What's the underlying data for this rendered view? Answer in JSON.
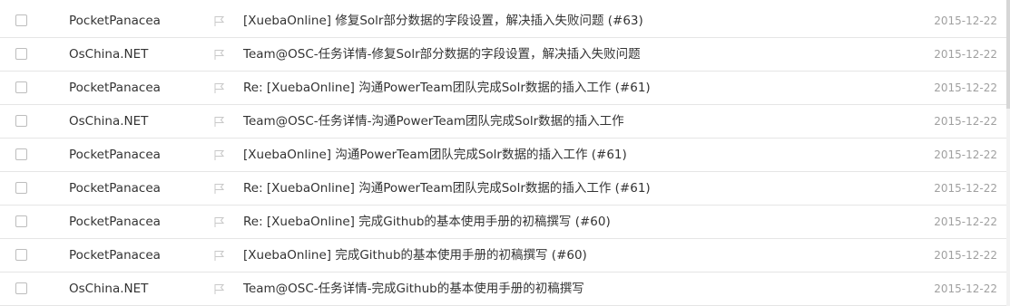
{
  "mails": [
    {
      "sender": "PocketPanacea",
      "subject": "[XuebaOnline] 修复Solr部分数据的字段设置，解决插入失败问题 (#63)",
      "date": "2015-12-22"
    },
    {
      "sender": "OsChina.NET",
      "subject": "Team@OSC-任务详情-修复Solr部分数据的字段设置，解决插入失败问题",
      "date": "2015-12-22"
    },
    {
      "sender": "PocketPanacea",
      "subject": "Re: [XuebaOnline] 沟通PowerTeam团队完成Solr数据的插入工作 (#61)",
      "date": "2015-12-22"
    },
    {
      "sender": "OsChina.NET",
      "subject": "Team@OSC-任务详情-沟通PowerTeam团队完成Solr数据的插入工作",
      "date": "2015-12-22"
    },
    {
      "sender": "PocketPanacea",
      "subject": "[XuebaOnline] 沟通PowerTeam团队完成Solr数据的插入工作 (#61)",
      "date": "2015-12-22"
    },
    {
      "sender": "PocketPanacea",
      "subject": "Re: [XuebaOnline] 沟通PowerTeam团队完成Solr数据的插入工作 (#61)",
      "date": "2015-12-22"
    },
    {
      "sender": "PocketPanacea",
      "subject": "Re: [XuebaOnline] 完成Github的基本使用手册的初稿撰写 (#60)",
      "date": "2015-12-22"
    },
    {
      "sender": "PocketPanacea",
      "subject": "[XuebaOnline] 完成Github的基本使用手册的初稿撰写 (#60)",
      "date": "2015-12-22"
    },
    {
      "sender": "OsChina.NET",
      "subject": "Team@OSC-任务详情-完成Github的基本使用手册的初稿撰写",
      "date": "2015-12-22"
    }
  ],
  "icons": {
    "checkbox": "checkbox-icon",
    "flag": "flag-icon"
  },
  "colors": {
    "text": "#333333",
    "date": "#a0a0a0",
    "divider": "#e5e5e5",
    "flag": "#c8c8c8"
  }
}
